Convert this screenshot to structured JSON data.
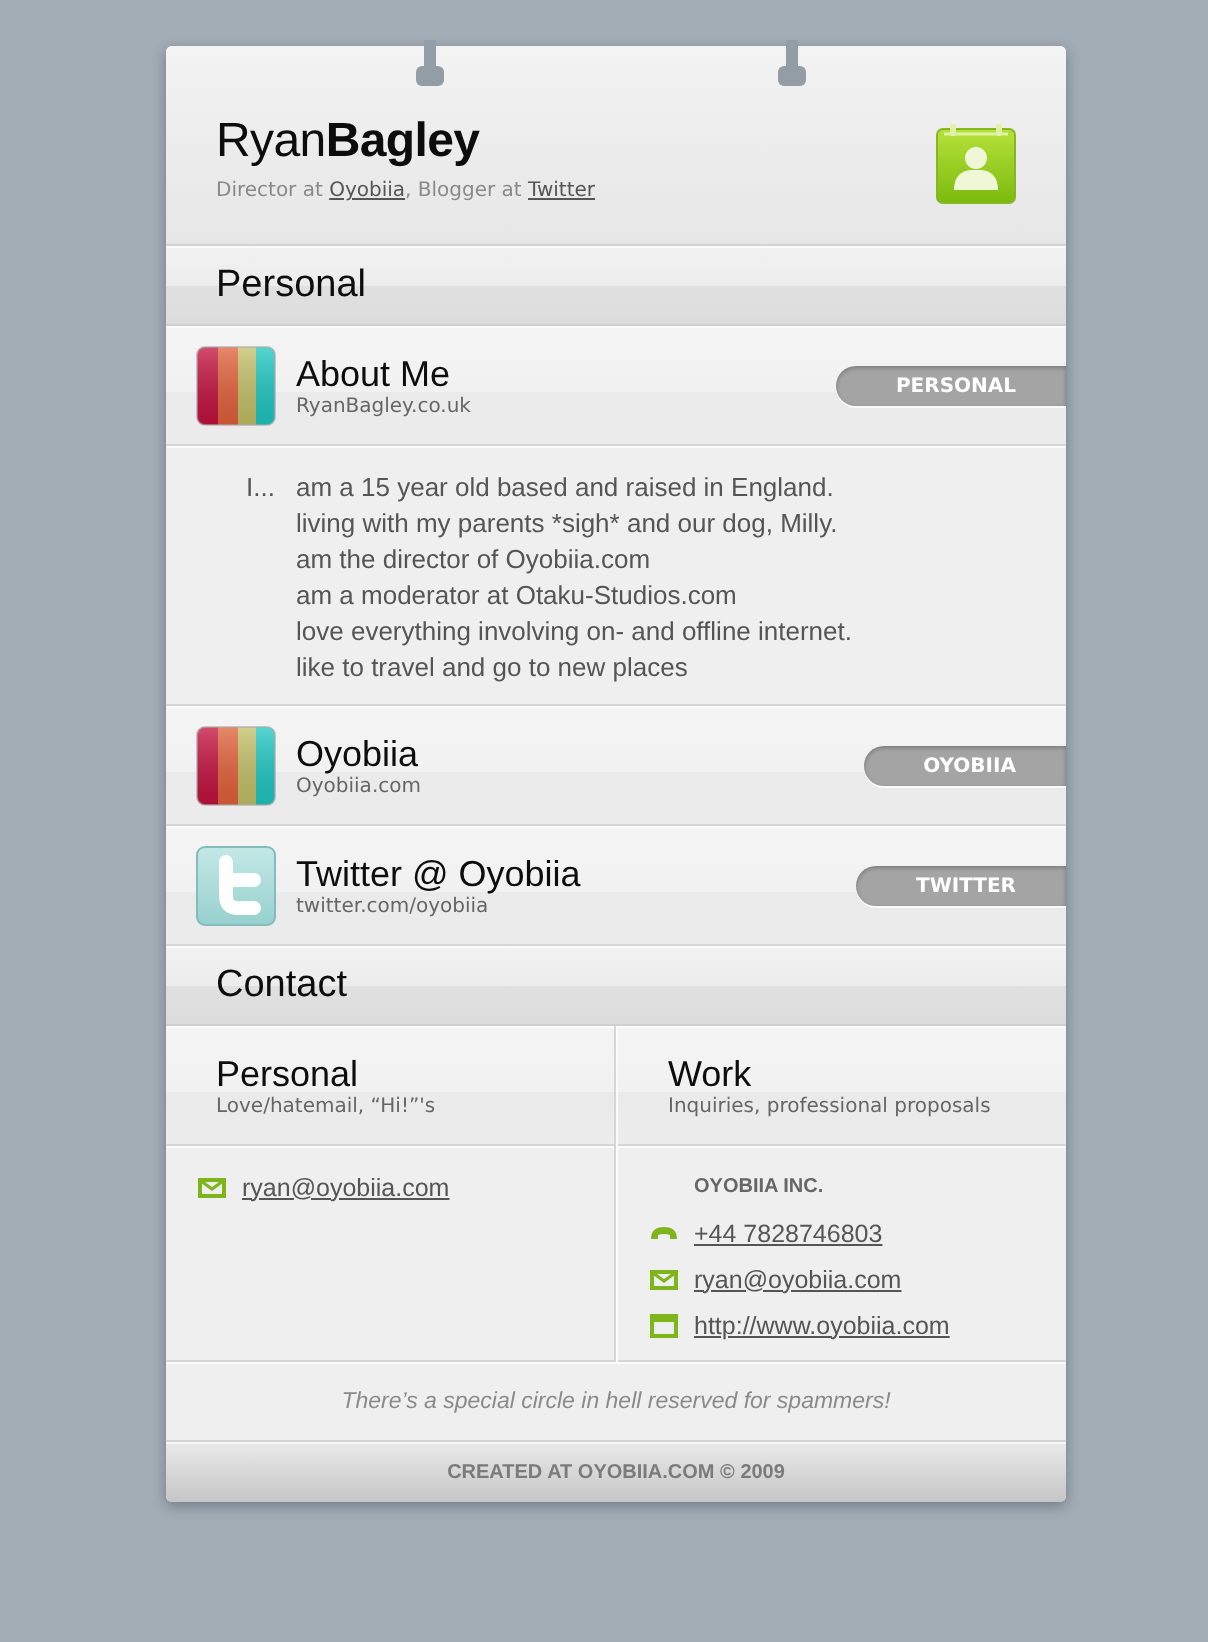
{
  "header": {
    "name": "Ryan**Bagley**",
    "subtitle": [
      {
        "kind": "text",
        "text": "Director at "
      },
      {
        "kind": "link",
        "text": "Oyobiia"
      },
      {
        "kind": "text",
        "text": ", Blogger at "
      },
      {
        "kind": "link",
        "text": "Twitter"
      }
    ]
  },
  "sections": [
    {
      "kind": "links",
      "title": "Personal",
      "items": [
        {
          "kind": "website",
          "title": "About Me",
          "subtitle": "RyanBagley.co.uk",
          "tag": "PERSONAL",
          "details": {
            "lead": "I...",
            "lines": [
              "am a 15 year old based and raised in England.",
              "living with my parents *sigh* and our dog, Milly.",
              "am the director of Oyobiia.com",
              "am a moderator at Otaku-Studios.com",
              "love everything involving on- and offline internet.",
              "like to travel and go to new places"
            ]
          }
        },
        {
          "kind": "website",
          "title": "Oyobiia",
          "subtitle": "Oyobiia.com",
          "tag": "OYOBIIA"
        },
        {
          "kind": "social",
          "title": "Twitter @ Oyobiia",
          "subtitle": "twitter.com/oyobiia",
          "tag": "TWITTER"
        }
      ]
    },
    {
      "kind": "contact",
      "title": "Contact",
      "columns": [
        {
          "title": "Personal",
          "subtitle": "Love/hatemail, “Hi!”'s",
          "entries": [
            {
              "kind": "email",
              "text": "ryan@oyobiia.com"
            }
          ]
        },
        {
          "title": "Work",
          "subtitle": "Inquiries, professional proposals",
          "company": "OYOBIIA INC.",
          "entries": [
            {
              "kind": "phone",
              "text": "+44 7828746803"
            },
            {
              "kind": "email",
              "text": "ryan@oyobiia.com"
            },
            {
              "kind": "web",
              "text": "http://www.oyobiia.com"
            }
          ]
        }
      ]
    }
  ],
  "note": "There’s a special circle in hell reserved for spammers!",
  "footer": "CREATED AT OYOBIIA.COM © 2009"
}
